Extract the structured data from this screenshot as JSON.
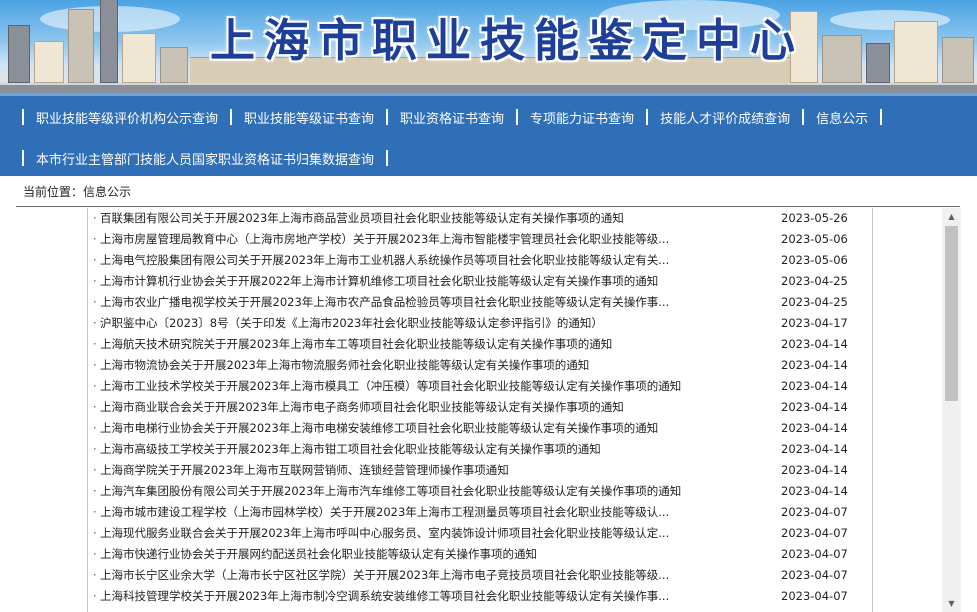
{
  "banner": {
    "title": "上海市职业技能鉴定中心"
  },
  "nav": {
    "row1": [
      "职业技能等级评价机构公示查询",
      "职业技能等级证书查询",
      "职业资格证书查询",
      "专项能力证书查询",
      "技能人才评价成绩查询",
      "信息公示"
    ],
    "row2": [
      "本市行业主管部门技能人员国家职业资格证书归集数据查询"
    ]
  },
  "breadcrumb": {
    "text": "当前位置：信息公示"
  },
  "list": {
    "rows": [
      {
        "title": "百联集团有限公司关于开展2023年上海市商品营业员项目社会化职业技能等级认定有关操作事项的通知",
        "date": "2023-05-26"
      },
      {
        "title": "上海市房屋管理局教育中心（上海市房地产学校）关于开展2023年上海市智能楼宇管理员社会化职业技能等级...",
        "date": "2023-05-06"
      },
      {
        "title": "上海电气控股集团有限公司关于开展2023年上海市工业机器人系统操作员等项目社会化职业技能等级认定有关...",
        "date": "2023-05-06"
      },
      {
        "title": "上海市计算机行业协会关于开展2022年上海市计算机维修工项目社会化职业技能等级认定有关操作事项的通知",
        "date": "2023-04-25"
      },
      {
        "title": "上海市农业广播电视学校关于开展2023年上海市农产品食品检验员等项目社会化职业技能等级认定有关操作事...",
        "date": "2023-04-25"
      },
      {
        "title": "沪职鉴中心〔2023〕8号（关于印发《上海市2023年社会化职业技能等级认定参评指引》的通知）",
        "date": "2023-04-17"
      },
      {
        "title": "上海航天技术研究院关于开展2023年上海市车工等项目社会化职业技能等级认定有关操作事项的通知",
        "date": "2023-04-14"
      },
      {
        "title": "上海市物流协会关于开展2023年上海市物流服务师社会化职业技能等级认定有关操作事项的通知",
        "date": "2023-04-14"
      },
      {
        "title": "上海市工业技术学校关于开展2023年上海市模具工（冲压模）等项目社会化职业技能等级认定有关操作事项的通知",
        "date": "2023-04-14"
      },
      {
        "title": "上海市商业联合会关于开展2023年上海市电子商务师项目社会化职业技能等级认定有关操作事项的通知",
        "date": "2023-04-14"
      },
      {
        "title": "上海市电梯行业协会关于开展2023年上海市电梯安装维修工项目社会化职业技能等级认定有关操作事项的通知",
        "date": "2023-04-14"
      },
      {
        "title": "上海市高级技工学校关于开展2023年上海市钳工项目社会化职业技能等级认定有关操作事项的通知",
        "date": "2023-04-14"
      },
      {
        "title": "上海商学院关于开展2023年上海市互联网营销师、连锁经营管理师操作事项通知",
        "date": "2023-04-14"
      },
      {
        "title": "上海汽车集团股份有限公司关于开展2023年上海市汽车维修工等项目社会化职业技能等级认定有关操作事项的通知",
        "date": "2023-04-14"
      },
      {
        "title": "上海市城市建设工程学校（上海市园林学校）关于开展2023年上海市工程测量员等项目社会化职业技能等级认...",
        "date": "2023-04-07"
      },
      {
        "title": "上海现代服务业联合会关于开展2023年上海市呼叫中心服务员、室内装饰设计师项目社会化职业技能等级认定...",
        "date": "2023-04-07"
      },
      {
        "title": "上海市快递行业协会关于开展网约配送员社会化职业技能等级认定有关操作事项的通知",
        "date": "2023-04-07"
      },
      {
        "title": "上海市长宁区业余大学（上海市长宁区社区学院）关于开展2023年上海市电子竞技员项目社会化职业技能等级...",
        "date": "2023-04-07"
      },
      {
        "title": "上海科技管理学校关于开展2023年上海市制冷空调系统安装维修工等项目社会化职业技能等级认定有关操作事...",
        "date": "2023-04-07"
      }
    ]
  },
  "icons": {
    "scroll_up": "triangle-up",
    "scroll_down": "triangle-down"
  }
}
